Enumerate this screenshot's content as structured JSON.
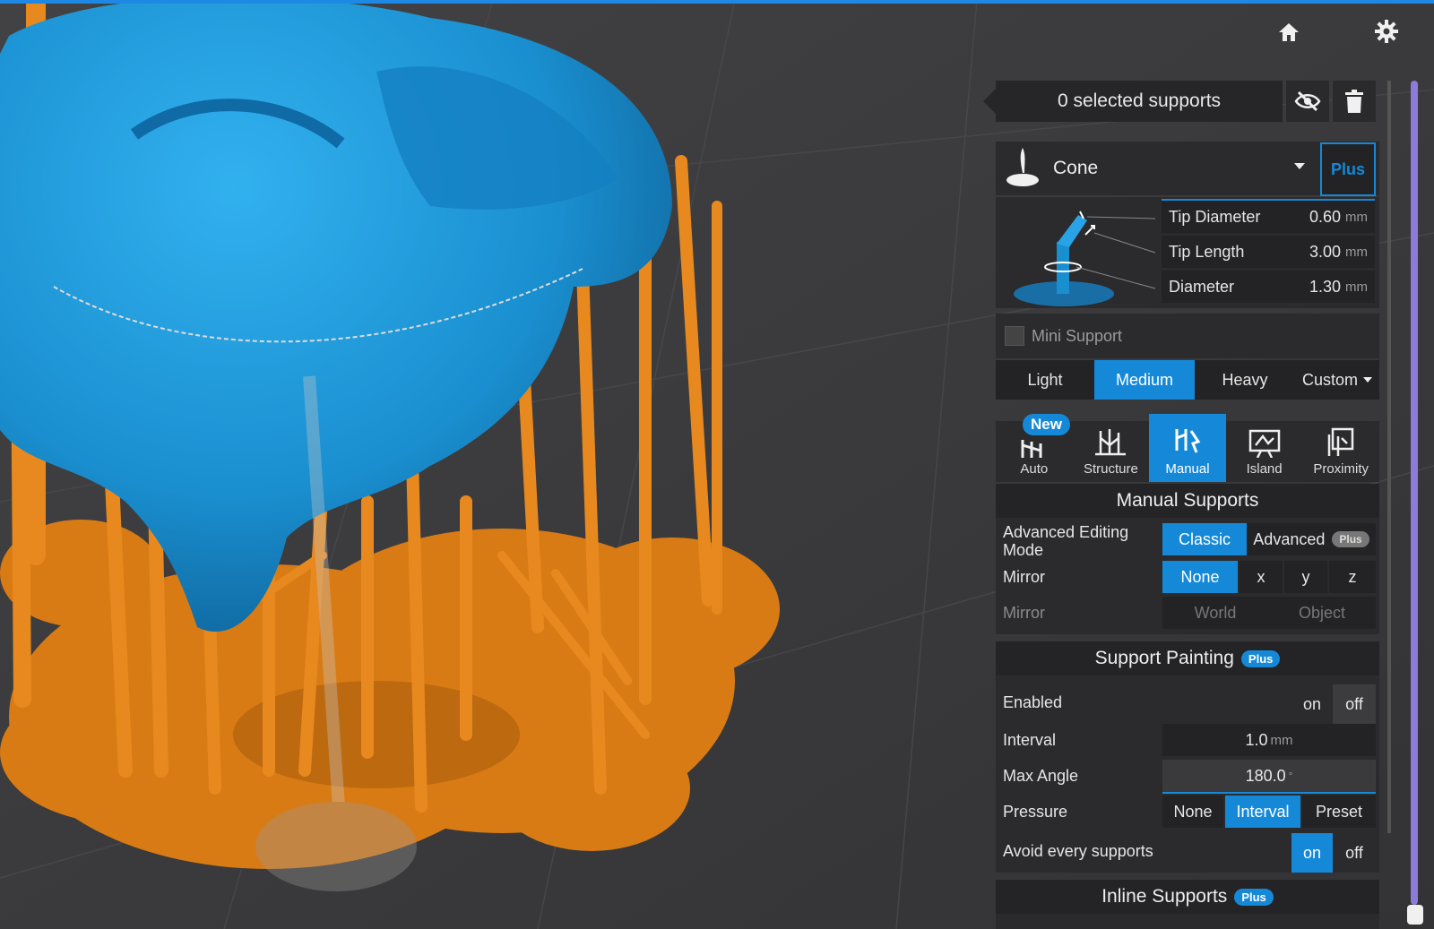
{
  "colors": {
    "accent": "#1589d8",
    "model": "#1a8fd0",
    "support": "#e8891f",
    "panel": "#2b2b2d"
  },
  "top_icons": {
    "home": "home-icon",
    "settings": "gear-icon"
  },
  "selection": {
    "label": "0 selected supports"
  },
  "support_type": {
    "name": "Cone",
    "plus": "Plus"
  },
  "tip_params": [
    {
      "name": "Tip Diameter",
      "value": "0.60",
      "unit": "mm"
    },
    {
      "name": "Tip Length",
      "value": "3.00",
      "unit": "mm"
    },
    {
      "name": "Diameter",
      "value": "1.30",
      "unit": "mm"
    }
  ],
  "mini_support": {
    "label": "Mini Support",
    "checked": false
  },
  "density": {
    "options": [
      "Light",
      "Medium",
      "Heavy",
      "Custom"
    ],
    "selected": "Medium"
  },
  "tools": {
    "items": [
      {
        "label": "Auto",
        "badge": "New"
      },
      {
        "label": "Structure"
      },
      {
        "label": "Manual"
      },
      {
        "label": "Island"
      },
      {
        "label": "Proximity"
      }
    ],
    "selected": "Manual"
  },
  "manual": {
    "title": "Manual Supports",
    "editing_label": "Advanced Editing Mode",
    "editing_options": [
      "Classic",
      "Advanced"
    ],
    "editing_plus": "Plus",
    "mirror_label": "Mirror",
    "mirror_options": [
      "None",
      "x",
      "y",
      "z"
    ],
    "mirror2_label": "Mirror",
    "mirror2_options": [
      "World",
      "Object"
    ]
  },
  "painting": {
    "title": "Support Painting",
    "plus": "Plus",
    "enabled_label": "Enabled",
    "enabled_on": "on",
    "enabled_off": "off",
    "interval_label": "Interval",
    "interval_value": "1.0",
    "interval_unit": "mm",
    "angle_label": "Max Angle",
    "angle_value": "180.0",
    "angle_unit": "°",
    "pressure_label": "Pressure",
    "pressure_options": [
      "None",
      "Interval",
      "Preset"
    ],
    "avoid_label": "Avoid every supports",
    "avoid_on": "on",
    "avoid_off": "off"
  },
  "inline": {
    "title": "Inline Supports",
    "plus": "Plus"
  }
}
